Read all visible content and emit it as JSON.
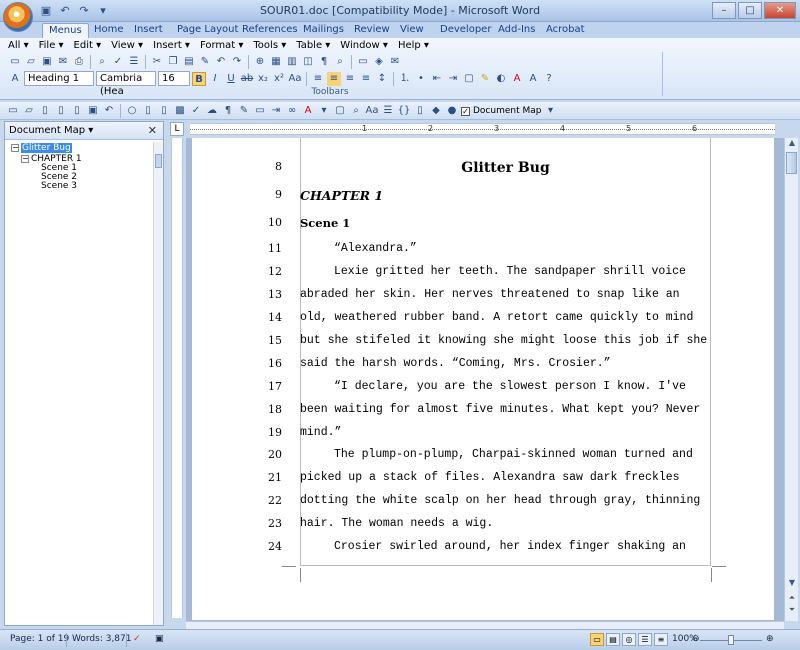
{
  "window": {
    "title": "SOUR01.doc [Compatibility Mode] - Microsoft Word",
    "controls": [
      "–",
      "□",
      "✕"
    ]
  },
  "tabs": [
    "Menus",
    "Home",
    "Insert",
    "Page Layout",
    "References",
    "Mailings",
    "Review",
    "View",
    "Developer",
    "Add-Ins",
    "Acrobat"
  ],
  "menus": [
    "All ▾",
    "File ▾",
    "Edit ▾",
    "View ▾",
    "Insert ▾",
    "Format ▾",
    "Tools ▾",
    "Table ▾",
    "Window ▾",
    "Help ▾"
  ],
  "formatting": {
    "style": "Heading 1",
    "font": "Cambria (Hea",
    "size": "16"
  },
  "toolbars_label": "Toolbars",
  "document_map_toggle": "Document Map",
  "doc_map": {
    "title": "Document Map",
    "close": "✕",
    "tree": {
      "root": "Glitter Bug",
      "chapter": "CHAPTER 1",
      "scenes": [
        "Scene 1",
        "Scene 2",
        "Scene 3"
      ]
    }
  },
  "ruler_numbers": [
    "1",
    "2",
    "3",
    "4",
    "5",
    "6"
  ],
  "document": {
    "lines": [
      {
        "n": "8",
        "text": "Glitter Bug",
        "style": "title"
      },
      {
        "n": "9",
        "text": "CHAPTER 1",
        "style": "chapter"
      },
      {
        "n": "10",
        "text": "Scene 1",
        "style": "scene"
      },
      {
        "n": "11",
        "text": "“Alexandra.”",
        "style": "indent"
      },
      {
        "n": "12",
        "text": "Lexie gritted her teeth.  The sandpaper shrill voice",
        "style": "indent"
      },
      {
        "n": "13",
        "text": "abraded her skin.  Her nerves threatened to snap like an",
        "style": "normal"
      },
      {
        "n": "14",
        "text": "old, weathered rubber band.  A retort came quickly to mind",
        "style": "normal"
      },
      {
        "n": "15",
        "text": "but she stifeled it knowing she might loose this job if she",
        "style": "normal"
      },
      {
        "n": "16",
        "text": "said the harsh words.  “Coming, Mrs. Crosier.”",
        "style": "normal"
      },
      {
        "n": "17",
        "text": "“I declare, you are the slowest person I know.  I've",
        "style": "indent"
      },
      {
        "n": "18",
        "text": "been waiting for almost five minutes.  What kept you?  Never",
        "style": "normal"
      },
      {
        "n": "19",
        "text": "mind.”",
        "style": "normal"
      },
      {
        "n": "20",
        "text": "The plump-on-plump, Charpai-skinned woman turned and",
        "style": "indent"
      },
      {
        "n": "21",
        "text": "picked up a stack of files.  Alexandra saw dark freckles",
        "style": "normal"
      },
      {
        "n": "22",
        "text": "dotting the white scalp on her head through gray, thinning",
        "style": "normal"
      },
      {
        "n": "23",
        "text": "hair.  The woman needs a wig.",
        "style": "normal"
      },
      {
        "n": "24",
        "text": "Crosier swirled around, her index finger shaking an",
        "style": "indent"
      }
    ]
  },
  "status_bar": {
    "page": "Page: 1 of 19",
    "words": "Words: 3,871",
    "zoom": "100%"
  },
  "colors": {
    "accent": "#15428b",
    "ribbon": "#dbe7f7",
    "doc_background": "#a5b9d5"
  }
}
